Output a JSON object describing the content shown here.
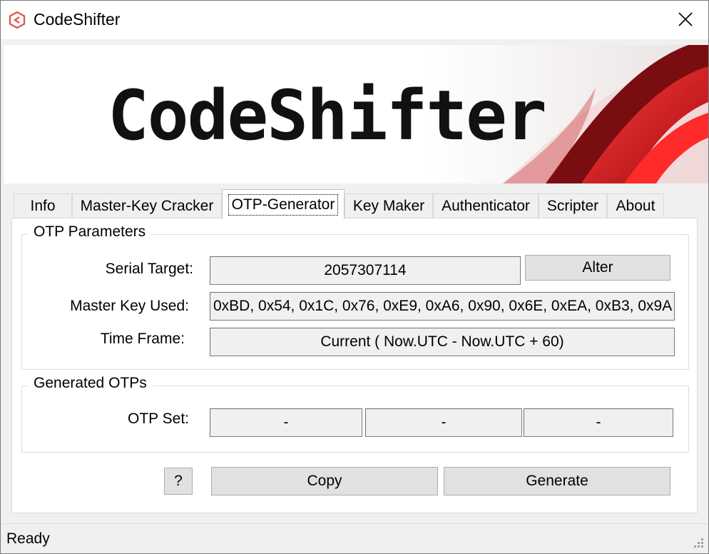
{
  "window": {
    "title": "CodeShifter"
  },
  "banner": {
    "logo_text": "CodeShifter"
  },
  "tabs": [
    {
      "label": "Info"
    },
    {
      "label": "Master-Key Cracker"
    },
    {
      "label": "OTP-Generator"
    },
    {
      "label": "Key Maker"
    },
    {
      "label": "Authenticator"
    },
    {
      "label": "Scripter"
    },
    {
      "label": "About"
    }
  ],
  "otp_parameters": {
    "group_title": "OTP Parameters",
    "serial_label": "Serial Target:",
    "serial_value": "2057307114",
    "alter_button": "Alter",
    "master_key_label": "Master Key Used:",
    "master_key_value": "0xBD, 0x54, 0x1C, 0x76, 0xE9, 0xA6, 0x90, 0x6E, 0xEA, 0xB3, 0x9A",
    "time_frame_label": "Time Frame:",
    "time_frame_value": "Current ( Now.UTC - Now.UTC + 60)"
  },
  "generated_otps": {
    "group_title": "Generated OTPs",
    "set_label": "OTP Set:",
    "values": [
      "-",
      "-",
      "-"
    ]
  },
  "actions": {
    "help_button": "?",
    "copy_button": "Copy",
    "generate_button": "Generate"
  },
  "status": {
    "text": "Ready"
  },
  "colors": {
    "accent_red": "#d0121b",
    "dark_red": "#7a0d10"
  }
}
